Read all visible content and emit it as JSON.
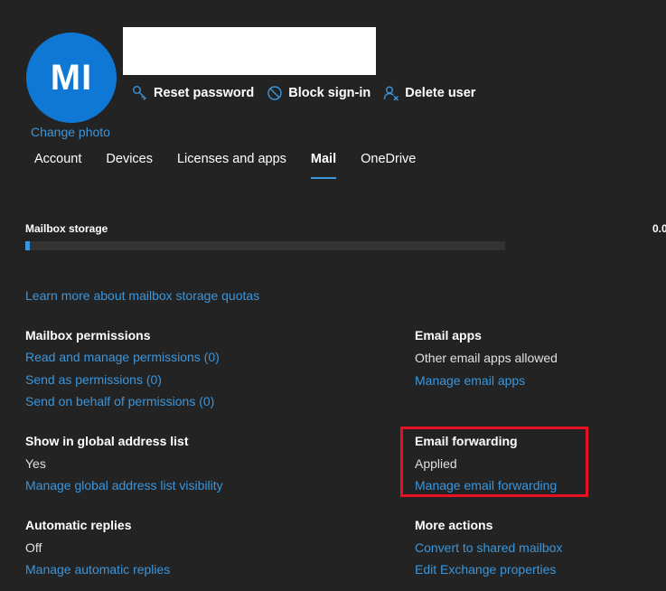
{
  "user": {
    "initials": "MI",
    "change_photo": "Change photo"
  },
  "actions": {
    "reset_password": "Reset password",
    "block_signin": "Block sign-in",
    "delete_user": "Delete user"
  },
  "tabs": [
    {
      "label": "Account"
    },
    {
      "label": "Devices"
    },
    {
      "label": "Licenses and apps"
    },
    {
      "label": "Mail"
    },
    {
      "label": "OneDrive"
    }
  ],
  "mailbox_storage": {
    "label": "Mailbox storage",
    "value_text": "0.0",
    "usage_fraction": 0.01,
    "learn_more": "Learn more about mailbox storage quotas"
  },
  "mailbox_permissions": {
    "heading": "Mailbox permissions",
    "read_manage": "Read and manage permissions (0)",
    "send_as": "Send as permissions (0)",
    "send_on_behalf": "Send on behalf of permissions (0)"
  },
  "email_apps": {
    "heading": "Email apps",
    "value": "Other email apps allowed",
    "link": "Manage email apps"
  },
  "global_address": {
    "heading": "Show in global address list",
    "value": "Yes",
    "link": "Manage global address list visibility"
  },
  "email_forwarding": {
    "heading": "Email forwarding",
    "value": "Applied",
    "link": "Manage email forwarding"
  },
  "automatic_replies": {
    "heading": "Automatic replies",
    "value": "Off",
    "link": "Manage automatic replies"
  },
  "more_actions": {
    "heading": "More actions",
    "convert": "Convert to shared mailbox",
    "edit_exchange": "Edit Exchange properties"
  },
  "colors": {
    "accent": "#3a96dd",
    "avatar": "#0f78d4",
    "highlight": "#e81123",
    "background": "#232323"
  }
}
